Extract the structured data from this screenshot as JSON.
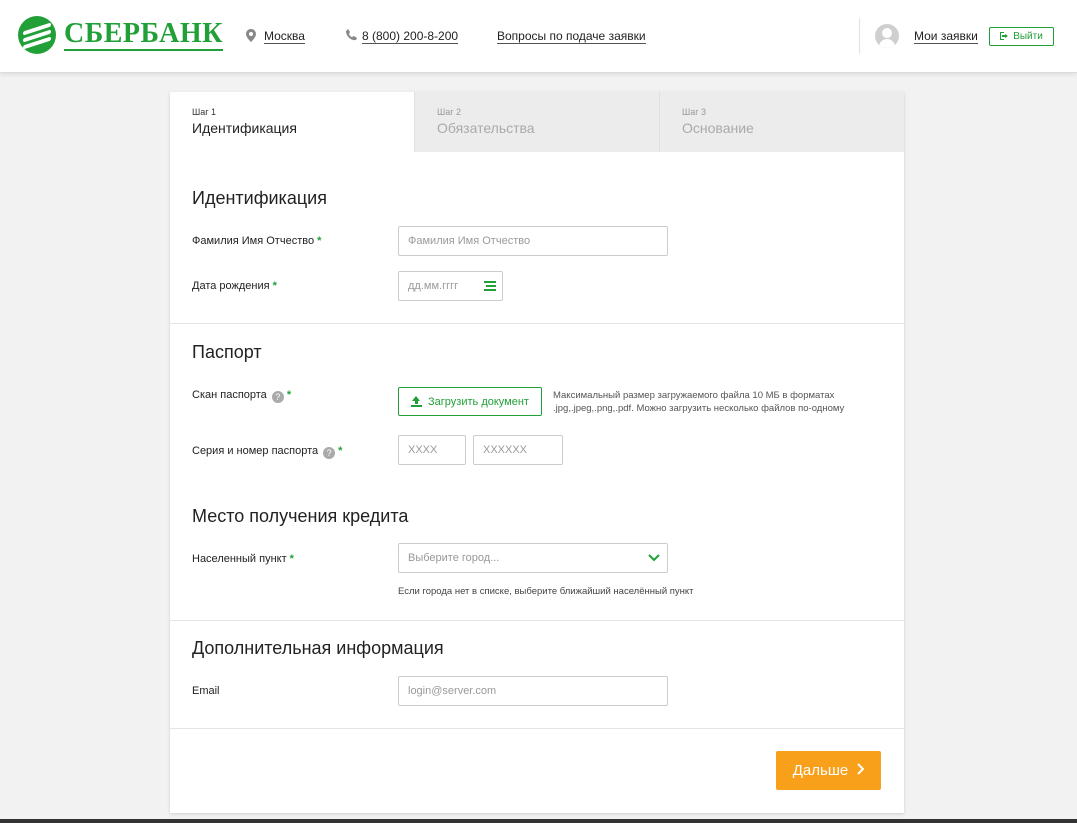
{
  "header": {
    "brand": "СБЕРБАНК",
    "city": "Москва",
    "phone": "8 (800) 200-8-200",
    "faq_link": "Вопросы по подаче заявки",
    "my_applications": "Мои заявки",
    "logout": "Выйти"
  },
  "steps": [
    {
      "step": "Шаг 1",
      "title": "Идентификация",
      "active": true
    },
    {
      "step": "Шаг 2",
      "title": "Обязательства",
      "active": false
    },
    {
      "step": "Шаг 3",
      "title": "Основание",
      "active": false
    }
  ],
  "identification": {
    "title": "Идентификация",
    "fio_label": "Фамилия Имя Отчество",
    "fio_placeholder": "Фамилия Имя Отчество",
    "birth_label": "Дата рождения",
    "birth_placeholder": "дд.мм.гггг"
  },
  "passport": {
    "title": "Паспорт",
    "scan_label": "Скан паспорта",
    "upload_button": "Загрузить документ",
    "upload_hint_line1": "Максимальный размер загружаемого файла 10 МБ в форматах",
    "upload_hint_line2": ".jpg,.jpeg,.png,.pdf. Можно загрузить несколько файлов по-одному",
    "number_label": "Серия и номер паспорта",
    "series_placeholder": "XXXX",
    "number_placeholder": "XXXXXX"
  },
  "credit_place": {
    "title": "Место получения кредита",
    "city_label": "Населенный пункт",
    "city_placeholder": "Выберите город...",
    "city_hint": "Если города нет в списке, выберите ближайший населённый пункт"
  },
  "additional": {
    "title": "Дополнительная информация",
    "email_label": "Email",
    "email_placeholder": "login@server.com"
  },
  "required_mark": "*",
  "help_mark": "?",
  "next_button": "Дальше",
  "colors": {
    "accent": "#21a038",
    "next": "#f9a01b"
  }
}
